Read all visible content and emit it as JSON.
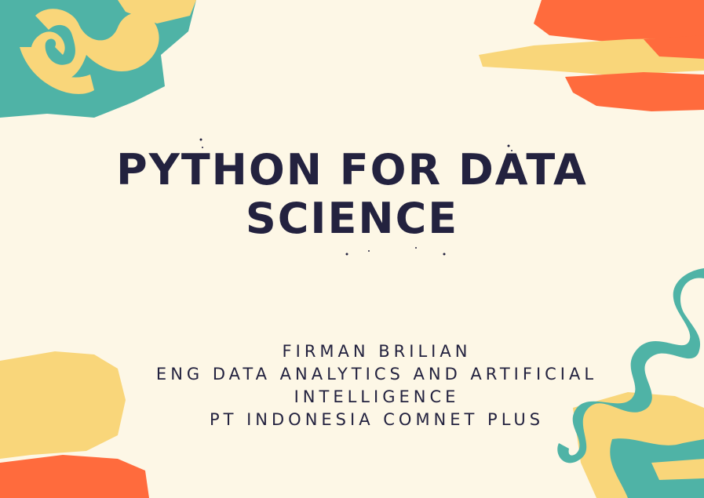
{
  "title": {
    "line1": "PYTHON FOR DATA",
    "line2": "SCIENCE"
  },
  "subtitle": {
    "name": "FIRMAN BRILIAN",
    "role_line1": "ENG DATA ANALYTICS AND ARTIFICIAL",
    "role_line2": "INTELLIGENCE",
    "company": "PT INDONESIA COMNET PLUS"
  },
  "colors": {
    "background": "#fdf7e6",
    "text": "#23223f",
    "teal": "#4fb3a6",
    "yellow": "#f9d67a",
    "orange": "#ff6b3d"
  }
}
